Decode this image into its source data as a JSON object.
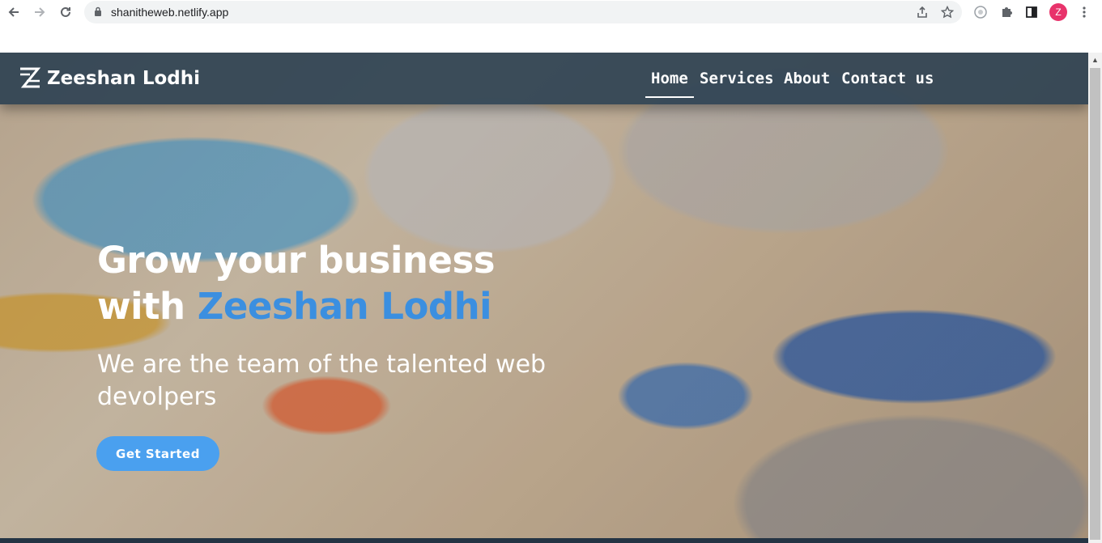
{
  "browser": {
    "url": "shanitheweb.netlify.app",
    "avatar_letter": "Z",
    "icons": [
      "back-arrow-icon",
      "forward-arrow-icon",
      "reload-icon",
      "lock-icon",
      "share-icon",
      "bookmark-star-icon",
      "extension-circle-icon",
      "puzzle-icon",
      "side-panel-icon",
      "kebab-menu-icon"
    ]
  },
  "navbar": {
    "brand": "Zeeshan Lodhi",
    "links": [
      "Home",
      "Services",
      "About",
      "Contact us"
    ],
    "active": "Home"
  },
  "hero": {
    "title_line1": "Grow your business",
    "title_with": "with",
    "title_brand": "Zeeshan Lodhi",
    "subtitle": "We are the team of the talented web devolpers",
    "cta_label": "Get Started"
  },
  "colors": {
    "accent": "#3b8fe0",
    "button": "#4aa0ef",
    "navbar": "#283e50"
  }
}
